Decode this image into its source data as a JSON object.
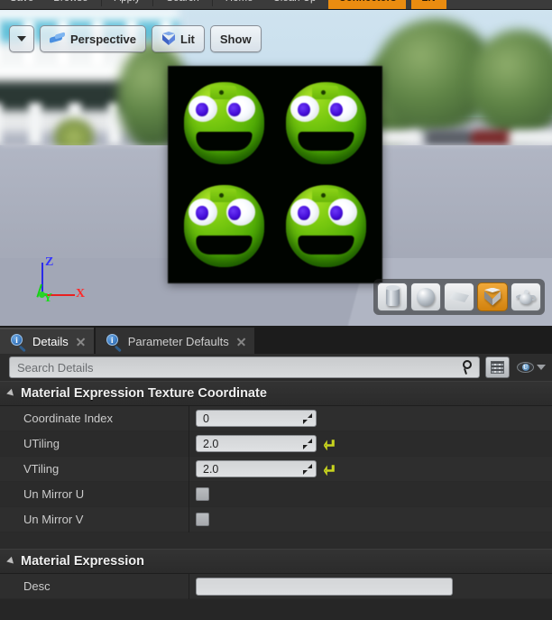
{
  "app_toolbar": {
    "items": [
      {
        "label": "Save",
        "type": "button"
      },
      {
        "label": "Browse",
        "type": "button"
      },
      {
        "label": "Apply",
        "type": "button"
      },
      {
        "label": "Search",
        "type": "button"
      },
      {
        "label": "Home",
        "type": "button"
      },
      {
        "label": "Clean Up",
        "type": "button"
      },
      {
        "label": "Connectors",
        "type": "accent"
      },
      {
        "label": "Liv",
        "type": "accent"
      }
    ],
    "accent_color": "#ea8c10"
  },
  "viewport": {
    "toolbar": {
      "menu_arrow_icon": "chevron-down-icon",
      "view_mode": "Perspective",
      "view_mode_icon": "perspective-camera-icon",
      "lighting_mode": "Lit",
      "lighting_mode_icon": "lit-cube-icon",
      "show_menu": "Show"
    },
    "gizmo": {
      "z_label": "Z",
      "y_label": "Y",
      "x_label": "X",
      "z_color": "#3434ff",
      "y_color": "#17e017",
      "x_color": "#ff2a2a"
    },
    "preview_shapes": [
      {
        "name": "cylinder",
        "active": false
      },
      {
        "name": "sphere",
        "active": false
      },
      {
        "name": "plane",
        "active": false
      },
      {
        "name": "cube",
        "active": true
      },
      {
        "name": "teapot",
        "active": false
      }
    ],
    "active_shape_color": "#e0930f",
    "mesh_description": "Cube preview mesh with a 2x2 tiled green pixel-art face texture on black background",
    "background_description": "Blurred outdoor HDRI backdrop: white building with cyan windows on the left, trees and parked cars on the right, light gray-blue ground plane"
  },
  "details_panel": {
    "tabs": [
      {
        "label": "Details",
        "icon": "details-info-icon",
        "active": true,
        "closable": true
      },
      {
        "label": "Parameter Defaults",
        "icon": "details-info-icon",
        "active": false,
        "closable": true
      }
    ],
    "search": {
      "placeholder": "Search Details",
      "value": "",
      "search_icon": "magnifier-icon"
    },
    "view_options": {
      "grid_view_icon": "grid-view-icon",
      "visibility_icon": "eye-icon",
      "dropdown_icon": "chevron-down-icon"
    },
    "sections": [
      {
        "title": "Material Expression Texture Coordinate",
        "expanded": true,
        "rows": [
          {
            "label": "Coordinate Index",
            "type": "number",
            "value": "0",
            "has_reset": false
          },
          {
            "label": "UTiling",
            "type": "number",
            "value": "2.0",
            "has_reset": true
          },
          {
            "label": "VTiling",
            "type": "number",
            "value": "2.0",
            "has_reset": true
          },
          {
            "label": "Un Mirror U",
            "type": "checkbox",
            "checked": false,
            "has_reset": false
          },
          {
            "label": "Un Mirror V",
            "type": "checkbox",
            "checked": false,
            "has_reset": false
          }
        ]
      },
      {
        "title": "Material Expression",
        "expanded": true,
        "rows": [
          {
            "label": "Desc",
            "type": "text",
            "value": "",
            "has_reset": false
          }
        ]
      }
    ],
    "reset_arrow_color": "#c8d41e"
  }
}
